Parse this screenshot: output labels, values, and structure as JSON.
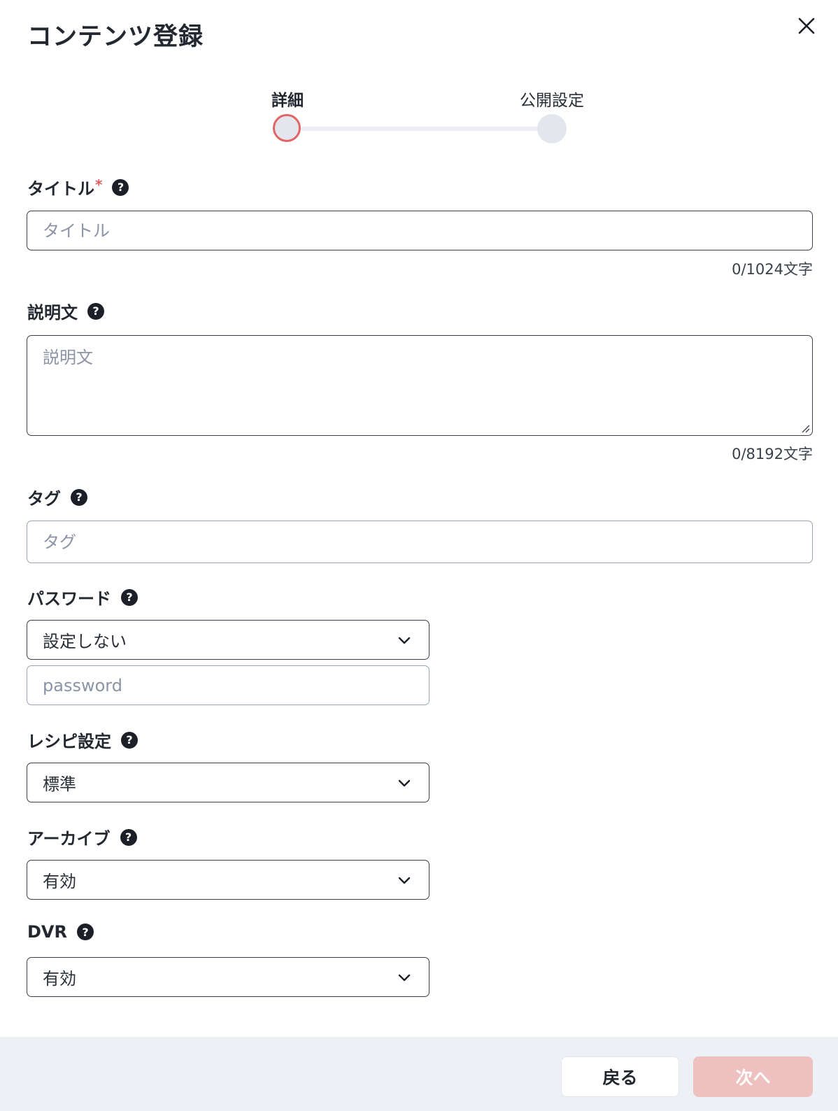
{
  "dialog": {
    "title": "コンテンツ登録",
    "close_icon": "close-icon"
  },
  "stepper": {
    "steps": [
      {
        "label": "詳細",
        "active": true
      },
      {
        "label": "公開設定",
        "active": false
      }
    ],
    "active_color": "#e26565"
  },
  "form": {
    "title_field": {
      "label": "タイトル",
      "required_mark": "*",
      "help": "?",
      "placeholder": "タイトル",
      "value": "",
      "counter": "0/1024文字"
    },
    "description_field": {
      "label": "説明文",
      "help": "?",
      "placeholder": "説明文",
      "value": "",
      "counter": "0/8192文字"
    },
    "tag_field": {
      "label": "タグ",
      "help": "?",
      "placeholder": "タグ",
      "value": ""
    },
    "password_field": {
      "label": "パスワード",
      "help": "?",
      "selected": "設定しない",
      "placeholder": "password",
      "value": ""
    },
    "recipe_field": {
      "label": "レシピ設定",
      "help": "?",
      "selected": "標準"
    },
    "archive_field": {
      "label": "アーカイブ",
      "help": "?",
      "selected": "有効"
    },
    "dvr_field": {
      "label": "DVR",
      "help": "?",
      "selected": "有効"
    }
  },
  "footer": {
    "back_label": "戻る",
    "next_label": "次へ",
    "next_color": "#eec0c0"
  }
}
